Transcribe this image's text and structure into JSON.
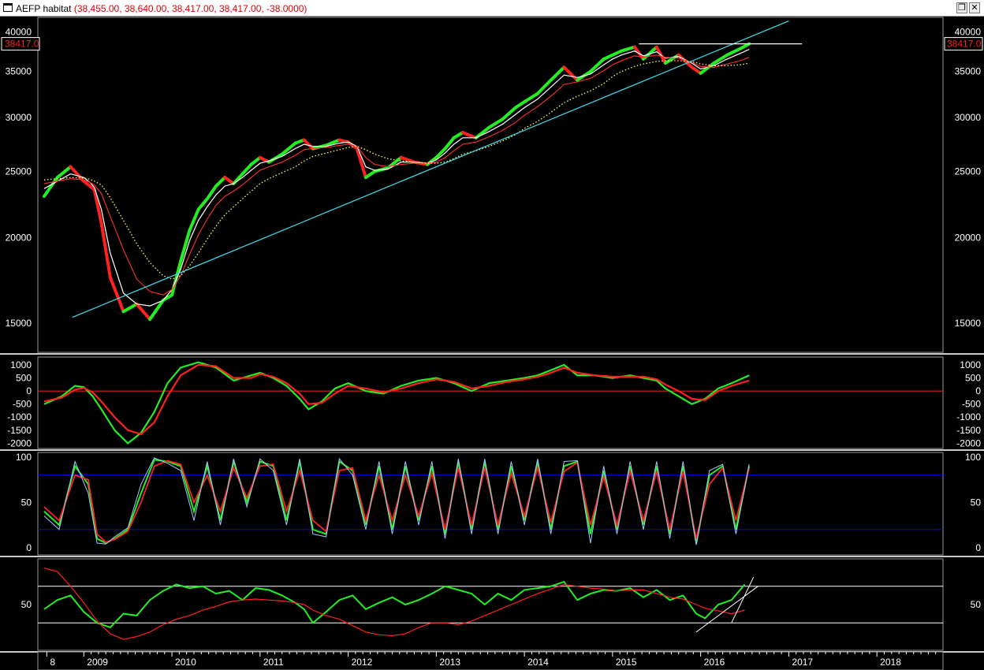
{
  "window": {
    "symbol": "AEFP habitat",
    "ohlc": "(38,455.00, 38,640.00, 38,417.00, 38,417.00, -38.0000)",
    "restore_icon": "restore-icon",
    "close_icon": "close-icon"
  },
  "colors": {
    "background": "#000000",
    "up_bar": "#22ee22",
    "down_bar": "#ff2020",
    "ma_fast": "#ffffff",
    "ma_mid": "#ff3030",
    "ma_slow": "#ffff66",
    "trendline": "#40e0f0",
    "oscillator_fast": "#22ee22",
    "oscillator_slow": "#ff2020",
    "band_line": "#0000ff",
    "stoch_k2": "#a0c8ff",
    "price_tag": "#ff2020"
  },
  "chart_data": [
    {
      "type": "line",
      "panel": "price",
      "yscale": "log",
      "ylim": [
        13600,
        42000
      ],
      "y_ticks": [
        15000,
        20000,
        25000,
        30000,
        35000,
        40000
      ],
      "last_price_label": "38417.0",
      "x_labels": [
        "8",
        "2009",
        "2010",
        "2011",
        "2012",
        "2013",
        "2014",
        "2015",
        "2016",
        "2017",
        "2018"
      ],
      "x": [
        2008.55,
        2008.7,
        2008.85,
        2009.0,
        2009.07,
        2009.12,
        2009.2,
        2009.3,
        2009.45,
        2009.6,
        2009.75,
        2009.9,
        2010.0,
        2010.1,
        2010.2,
        2010.3,
        2010.4,
        2010.5,
        2010.6,
        2010.7,
        2010.8,
        2010.9,
        2011.0,
        2011.1,
        2011.25,
        2011.4,
        2011.5,
        2011.6,
        2011.75,
        2011.9,
        2012.0,
        2012.1,
        2012.2,
        2012.3,
        2012.45,
        2012.6,
        2012.75,
        2012.9,
        2013.0,
        2013.1,
        2013.2,
        2013.3,
        2013.45,
        2013.6,
        2013.75,
        2013.9,
        2014.0,
        2014.15,
        2014.3,
        2014.45,
        2014.6,
        2014.75,
        2014.9,
        2015.0,
        2015.1,
        2015.25,
        2015.35,
        2015.5,
        2015.6,
        2015.75,
        2015.9,
        2016.0,
        2016.15,
        2016.3,
        2016.45,
        2016.55
      ],
      "series": [
        {
          "role": "price",
          "values": [
            23000,
            24500,
            25400,
            24200,
            23800,
            23500,
            21000,
            17500,
            15600,
            16000,
            15200,
            16200,
            16500,
            18500,
            20500,
            22000,
            22800,
            23800,
            24500,
            24000,
            24800,
            25600,
            26200,
            25800,
            26500,
            27500,
            27800,
            27000,
            27300,
            27800,
            27600,
            27000,
            24500,
            25000,
            25300,
            26200,
            25800,
            25600,
            26200,
            27000,
            28000,
            28500,
            28000,
            29000,
            29800,
            31000,
            31600,
            32500,
            34000,
            35500,
            34000,
            35000,
            36500,
            37000,
            37500,
            38000,
            36500,
            38000,
            36000,
            37000,
            35500,
            34800,
            36000,
            37000,
            37800,
            38417
          ]
        },
        {
          "role": "ma_fast",
          "values": [
            23600,
            24200,
            24800,
            24500,
            24100,
            23700,
            22000,
            19000,
            16600,
            16000,
            15900,
            16200,
            16800,
            18000,
            19800,
            21200,
            22200,
            23100,
            23800,
            24000,
            24500,
            25100,
            25700,
            25900,
            26300,
            27000,
            27400,
            27200,
            27200,
            27500,
            27600,
            27200,
            25400,
            25100,
            25200,
            25800,
            25800,
            25700,
            26000,
            26600,
            27400,
            28000,
            28000,
            28600,
            29300,
            30300,
            31000,
            31900,
            33200,
            34600,
            34300,
            34700,
            35800,
            36500,
            37000,
            37500,
            36900,
            37400,
            36600,
            36800,
            36000,
            35300,
            35700,
            36500,
            37200,
            37700
          ]
        },
        {
          "role": "ma_mid",
          "values": [
            24000,
            24200,
            24400,
            24300,
            24100,
            23900,
            23200,
            21500,
            19200,
            17400,
            16700,
            16500,
            16800,
            17600,
            18900,
            20200,
            21300,
            22300,
            23000,
            23400,
            23900,
            24500,
            25100,
            25400,
            25800,
            26400,
            26900,
            27000,
            27100,
            27300,
            27400,
            27200,
            26200,
            25600,
            25400,
            25600,
            25700,
            25700,
            25800,
            26200,
            26800,
            27400,
            27600,
            28100,
            28700,
            29500,
            30200,
            31100,
            32200,
            33500,
            33800,
            34200,
            35100,
            35800,
            36300,
            36900,
            36700,
            37000,
            36700,
            36600,
            36100,
            35600,
            35500,
            35900,
            36300,
            36700
          ]
        },
        {
          "role": "ma_slow",
          "values": [
            24300,
            24400,
            24500,
            24450,
            24350,
            24200,
            23900,
            22900,
            21200,
            19600,
            18400,
            17600,
            17400,
            17600,
            18200,
            19000,
            19900,
            20800,
            21600,
            22200,
            22800,
            23400,
            24000,
            24400,
            24900,
            25400,
            25900,
            26300,
            26600,
            26900,
            27100,
            27200,
            26900,
            26500,
            26100,
            25900,
            25800,
            25700,
            25700,
            25800,
            26100,
            26500,
            26800,
            27200,
            27700,
            28300,
            28900,
            29600,
            30500,
            31500,
            32200,
            32800,
            33600,
            34400,
            35000,
            35600,
            35900,
            36200,
            36300,
            36300,
            36200,
            35900,
            35700,
            35700,
            35800,
            36000
          ]
        }
      ],
      "trendline": {
        "x": [
          2008.87,
          2017.0
        ],
        "y": [
          15300,
          41500
        ]
      },
      "resistance": {
        "x": [
          2015.3,
          2017.15
        ],
        "y": [
          38417,
          38417
        ]
      },
      "grid": false
    },
    {
      "type": "line",
      "panel": "momentum",
      "ylim": [
        -2200,
        1300
      ],
      "y_ticks": [
        1000,
        500,
        0,
        -500,
        -1000,
        -1500,
        -2000
      ],
      "zero_line": 0,
      "x": [
        2008.55,
        2008.75,
        2008.9,
        2009.0,
        2009.1,
        2009.2,
        2009.35,
        2009.5,
        2009.65,
        2009.8,
        2009.95,
        2010.1,
        2010.3,
        2010.5,
        2010.7,
        2010.9,
        2011.0,
        2011.15,
        2011.3,
        2011.45,
        2011.55,
        2011.7,
        2011.85,
        2012.0,
        2012.2,
        2012.4,
        2012.6,
        2012.8,
        2013.0,
        2013.2,
        2013.4,
        2013.6,
        2013.8,
        2014.0,
        2014.15,
        2014.3,
        2014.45,
        2014.6,
        2014.8,
        2015.0,
        2015.2,
        2015.35,
        2015.5,
        2015.6,
        2015.75,
        2015.9,
        2016.05,
        2016.2,
        2016.35,
        2016.55
      ],
      "series": [
        {
          "role": "fast",
          "values": [
            -500,
            -200,
            200,
            150,
            -200,
            -700,
            -1500,
            -2000,
            -1600,
            -800,
            300,
            900,
            1100,
            900,
            400,
            600,
            700,
            500,
            200,
            -300,
            -700,
            -400,
            100,
            300,
            0,
            -100,
            200,
            400,
            500,
            300,
            0,
            300,
            400,
            500,
            600,
            800,
            1000,
            600,
            600,
            500,
            600,
            500,
            400,
            100,
            -200,
            -500,
            -300,
            100,
            300,
            600
          ]
        },
        {
          "role": "slow",
          "values": [
            -400,
            -250,
            50,
            120,
            -50,
            -400,
            -1000,
            -1500,
            -1650,
            -1200,
            -200,
            600,
            1000,
            950,
            500,
            500,
            650,
            550,
            300,
            -100,
            -500,
            -450,
            -100,
            200,
            100,
            -50,
            100,
            300,
            450,
            350,
            100,
            200,
            350,
            450,
            550,
            700,
            900,
            700,
            600,
            550,
            550,
            550,
            450,
            250,
            0,
            -300,
            -350,
            0,
            200,
            400
          ]
        }
      ]
    },
    {
      "type": "line",
      "panel": "stochastic",
      "ylim": [
        -8,
        105
      ],
      "y_ticks": [
        0,
        50,
        100
      ],
      "bands": [
        20,
        80
      ],
      "x": [
        2008.55,
        2008.72,
        2008.9,
        2009.05,
        2009.15,
        2009.25,
        2009.35,
        2009.5,
        2009.65,
        2009.8,
        2009.95,
        2010.1,
        2010.25,
        2010.4,
        2010.55,
        2010.7,
        2010.85,
        2011.0,
        2011.15,
        2011.3,
        2011.45,
        2011.6,
        2011.75,
        2011.9,
        2012.05,
        2012.2,
        2012.35,
        2012.5,
        2012.65,
        2012.8,
        2012.95,
        2013.1,
        2013.25,
        2013.4,
        2013.55,
        2013.7,
        2013.85,
        2014.0,
        2014.15,
        2014.3,
        2014.45,
        2014.6,
        2014.75,
        2014.9,
        2015.05,
        2015.2,
        2015.35,
        2015.5,
        2015.65,
        2015.8,
        2015.95,
        2016.1,
        2016.25,
        2016.4,
        2016.55
      ],
      "series": [
        {
          "role": "k",
          "values": [
            40,
            25,
            90,
            70,
            10,
            5,
            10,
            20,
            60,
            97,
            95,
            90,
            40,
            90,
            30,
            95,
            50,
            95,
            90,
            30,
            95,
            20,
            15,
            95,
            85,
            25,
            90,
            20,
            90,
            30,
            90,
            15,
            95,
            20,
            95,
            20,
            90,
            30,
            95,
            20,
            90,
            95,
            15,
            85,
            20,
            90,
            25,
            90,
            15,
            90,
            5,
            80,
            90,
            20,
            90
          ]
        },
        {
          "role": "d",
          "values": [
            45,
            30,
            80,
            75,
            15,
            6,
            9,
            18,
            50,
            90,
            96,
            92,
            50,
            80,
            40,
            88,
            55,
            90,
            92,
            40,
            85,
            30,
            18,
            85,
            88,
            30,
            80,
            30,
            80,
            35,
            82,
            20,
            88,
            25,
            88,
            25,
            82,
            35,
            88,
            28,
            84,
            94,
            25,
            78,
            25,
            84,
            30,
            84,
            20,
            84,
            10,
            70,
            88,
            30,
            88
          ]
        },
        {
          "role": "k2",
          "values": [
            35,
            20,
            95,
            60,
            5,
            4,
            12,
            22,
            70,
            99,
            93,
            85,
            30,
            95,
            25,
            98,
            45,
            98,
            85,
            25,
            98,
            15,
            12,
            98,
            80,
            20,
            95,
            15,
            95,
            25,
            95,
            10,
            98,
            15,
            98,
            15,
            95,
            25,
            98,
            15,
            95,
            96,
            5,
            90,
            15,
            95,
            20,
            95,
            10,
            95,
            3,
            85,
            92,
            15,
            92
          ]
        }
      ]
    },
    {
      "type": "line",
      "panel": "rsi",
      "ylim": [
        0,
        100
      ],
      "y_ticks": [
        50
      ],
      "bands": [
        30,
        70
      ],
      "x": [
        2008.55,
        2008.7,
        2008.85,
        2009.0,
        2009.15,
        2009.3,
        2009.45,
        2009.6,
        2009.75,
        2009.9,
        2010.05,
        2010.2,
        2010.35,
        2010.5,
        2010.65,
        2010.8,
        2010.95,
        2011.1,
        2011.25,
        2011.4,
        2011.5,
        2011.6,
        2011.75,
        2011.9,
        2012.05,
        2012.2,
        2012.35,
        2012.5,
        2012.65,
        2012.8,
        2012.95,
        2013.1,
        2013.25,
        2013.4,
        2013.55,
        2013.7,
        2013.85,
        2014.0,
        2014.15,
        2014.3,
        2014.45,
        2014.6,
        2014.75,
        2014.9,
        2015.05,
        2015.2,
        2015.35,
        2015.5,
        2015.65,
        2015.8,
        2015.95,
        2016.05,
        2016.2,
        2016.35,
        2016.5
      ],
      "series": [
        {
          "role": "rsi",
          "values": [
            45,
            55,
            60,
            42,
            30,
            25,
            40,
            38,
            55,
            65,
            72,
            68,
            70,
            62,
            65,
            55,
            68,
            66,
            60,
            52,
            45,
            30,
            42,
            55,
            60,
            45,
            52,
            58,
            50,
            55,
            62,
            70,
            66,
            62,
            50,
            62,
            55,
            66,
            68,
            70,
            75,
            55,
            62,
            66,
            65,
            68,
            58,
            66,
            55,
            60,
            40,
            35,
            50,
            55,
            72
          ]
        },
        {
          "role": "rsi_avg",
          "values": [
            90,
            86,
            70,
            52,
            32,
            18,
            12,
            15,
            20,
            28,
            34,
            38,
            44,
            48,
            53,
            55,
            56,
            55,
            54,
            52,
            50,
            44,
            38,
            34,
            27,
            20,
            17,
            16,
            18,
            25,
            30,
            30,
            28,
            32,
            38,
            44,
            50,
            56,
            62,
            67,
            72,
            70,
            68,
            67,
            65,
            66,
            66,
            62,
            58,
            56,
            50,
            46,
            43,
            40,
            44
          ]
        }
      ],
      "trendlines": [
        {
          "x": [
            2015.95,
            2016.65
          ],
          "y": [
            20,
            70
          ]
        },
        {
          "x": [
            2016.35,
            2016.6
          ],
          "y": [
            30,
            80
          ]
        }
      ]
    }
  ]
}
